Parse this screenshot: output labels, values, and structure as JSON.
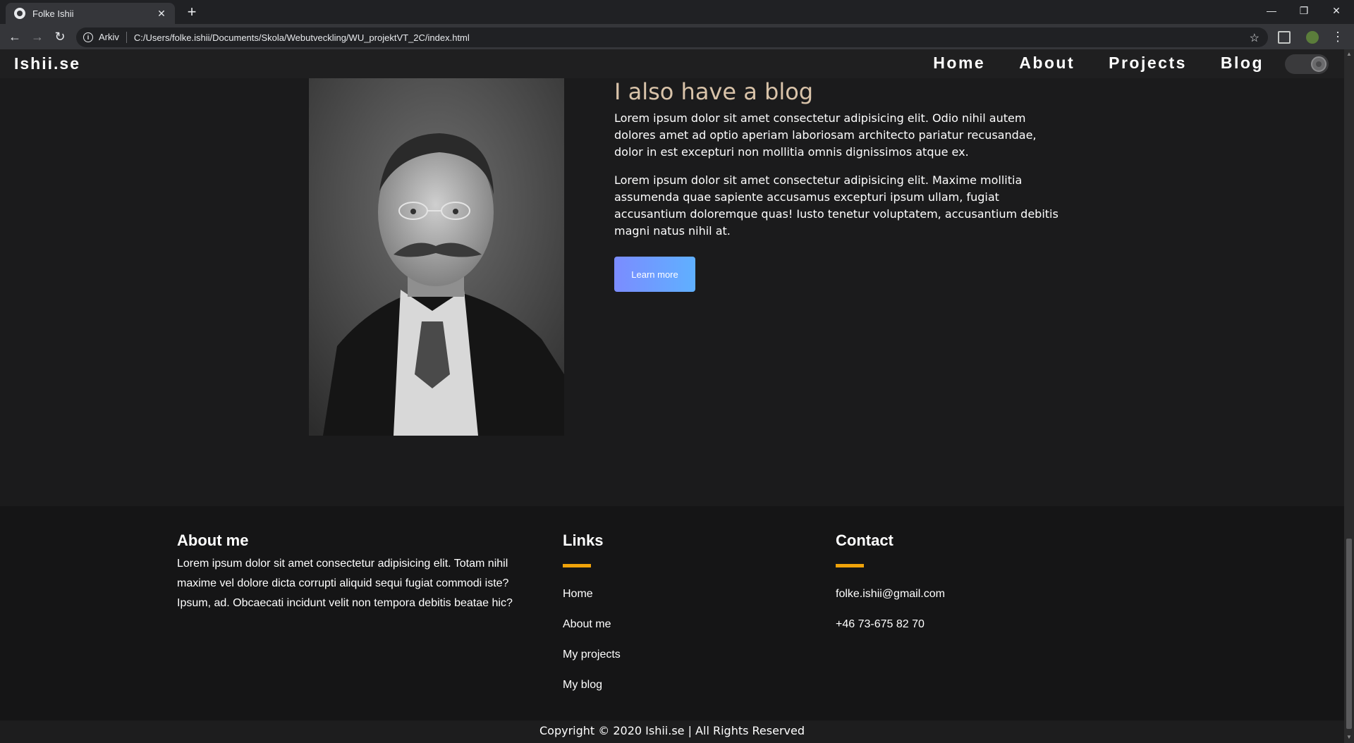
{
  "browser": {
    "tab_title": "Folke Ishii",
    "tab_close": "✕",
    "new_tab": "+",
    "win_minimize": "—",
    "win_restore": "❐",
    "win_close": "✕",
    "back": "←",
    "forward": "→",
    "reload": "↻",
    "info_chip": "Arkiv",
    "url": "C:/Users/folke.ishii/Documents/Skola/Webutveckling/WU_projektVT_2C/index.html",
    "star": "☆",
    "menu": "⋮"
  },
  "site": {
    "logo": "Ishii.se",
    "nav": [
      "Home",
      "About",
      "Projects",
      "Blog"
    ]
  },
  "blog": {
    "title": "I also have a blog",
    "paragraphs": [
      "Lorem ipsum dolor sit amet consectetur adipisicing elit. Odio nihil autem dolores amet ad optio aperiam laboriosam architecto pariatur recusandae, dolor in est excepturi non mollitia omnis dignissimos atque ex.",
      "Lorem ipsum dolor sit amet consectetur adipisicing elit. Maxime mollitia assumenda quae sapiente accusamus excepturi ipsum ullam, fugiat accusantium doloremque quas! Iusto tenetur voluptatem, accusantium debitis magni natus nihil at."
    ],
    "button": "Learn more"
  },
  "footer": {
    "about": {
      "heading": "About me",
      "text": "Lorem ipsum dolor sit amet consectetur adipisicing elit. Totam nihil maxime vel dolore dicta corrupti aliquid sequi fugiat commodi iste? Ipsum, ad. Obcaecati incidunt velit non tempora debitis beatae hic?"
    },
    "links": {
      "heading": "Links",
      "items": [
        "Home",
        "About me",
        "My projects",
        "My blog"
      ]
    },
    "contact": {
      "heading": "Contact",
      "email": "folke.ishii@gmail.com",
      "phone": "+46 73-675 82 70"
    },
    "copyright": "Copyright © 2020 Ishii.se | All Rights Reserved"
  },
  "colors": {
    "accent_bar": "#f0a30a",
    "blog_title": "#d9c3a9",
    "button_gradient_start": "#7b8cff",
    "button_gradient_end": "#5fb0ff"
  }
}
